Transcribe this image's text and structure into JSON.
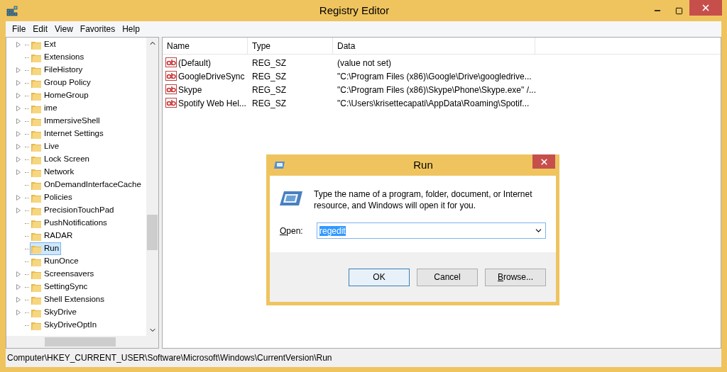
{
  "window": {
    "title": "Registry Editor"
  },
  "menu": [
    "File",
    "Edit",
    "View",
    "Favorites",
    "Help"
  ],
  "tree": [
    {
      "label": "Ext",
      "has_children": true,
      "selected": false
    },
    {
      "label": "Extensions",
      "has_children": false,
      "selected": false
    },
    {
      "label": "FileHistory",
      "has_children": true,
      "selected": false
    },
    {
      "label": "Group Policy",
      "has_children": true,
      "selected": false
    },
    {
      "label": "HomeGroup",
      "has_children": true,
      "selected": false
    },
    {
      "label": "ime",
      "has_children": true,
      "selected": false
    },
    {
      "label": "ImmersiveShell",
      "has_children": true,
      "selected": false
    },
    {
      "label": "Internet Settings",
      "has_children": true,
      "selected": false
    },
    {
      "label": "Live",
      "has_children": true,
      "selected": false
    },
    {
      "label": "Lock Screen",
      "has_children": true,
      "selected": false
    },
    {
      "label": "Network",
      "has_children": true,
      "selected": false
    },
    {
      "label": "OnDemandInterfaceCache",
      "has_children": false,
      "selected": false
    },
    {
      "label": "Policies",
      "has_children": true,
      "selected": false
    },
    {
      "label": "PrecisionTouchPad",
      "has_children": true,
      "selected": false
    },
    {
      "label": "PushNotifications",
      "has_children": false,
      "selected": false
    },
    {
      "label": "RADAR",
      "has_children": false,
      "selected": false
    },
    {
      "label": "Run",
      "has_children": false,
      "selected": true
    },
    {
      "label": "RunOnce",
      "has_children": false,
      "selected": false
    },
    {
      "label": "Screensavers",
      "has_children": true,
      "selected": false
    },
    {
      "label": "SettingSync",
      "has_children": true,
      "selected": false
    },
    {
      "label": "Shell Extensions",
      "has_children": true,
      "selected": false
    },
    {
      "label": "SkyDrive",
      "has_children": true,
      "selected": false
    },
    {
      "label": "SkyDriveOptIn",
      "has_children": false,
      "selected": false
    }
  ],
  "table": {
    "columns": [
      "Name",
      "Type",
      "Data"
    ],
    "rows": [
      {
        "name": "(Default)",
        "type": "REG_SZ",
        "data": "(value not set)"
      },
      {
        "name": "GoogleDriveSync",
        "type": "REG_SZ",
        "data": "\"C:\\Program Files (x86)\\Google\\Drive\\googledrive..."
      },
      {
        "name": "Skype",
        "type": "REG_SZ",
        "data": "\"C:\\Program Files (x86)\\Skype\\Phone\\Skype.exe\" /..."
      },
      {
        "name": "Spotify Web Hel...",
        "type": "REG_SZ",
        "data": "\"C:\\Users\\krisettecapati\\AppData\\Roaming\\Spotif..."
      }
    ]
  },
  "status_bar": "Computer\\HKEY_CURRENT_USER\\Software\\Microsoft\\Windows\\CurrentVersion\\Run",
  "dialog": {
    "title": "Run",
    "message": "Type the name of a program, folder, document, or Internet resource, and Windows will open it for you.",
    "open_label": "Open:",
    "open_value": "regedit",
    "buttons": [
      {
        "label": "OK",
        "default": true
      },
      {
        "label": "Cancel",
        "default": false
      },
      {
        "label": "Browse...",
        "default": false
      }
    ]
  }
}
